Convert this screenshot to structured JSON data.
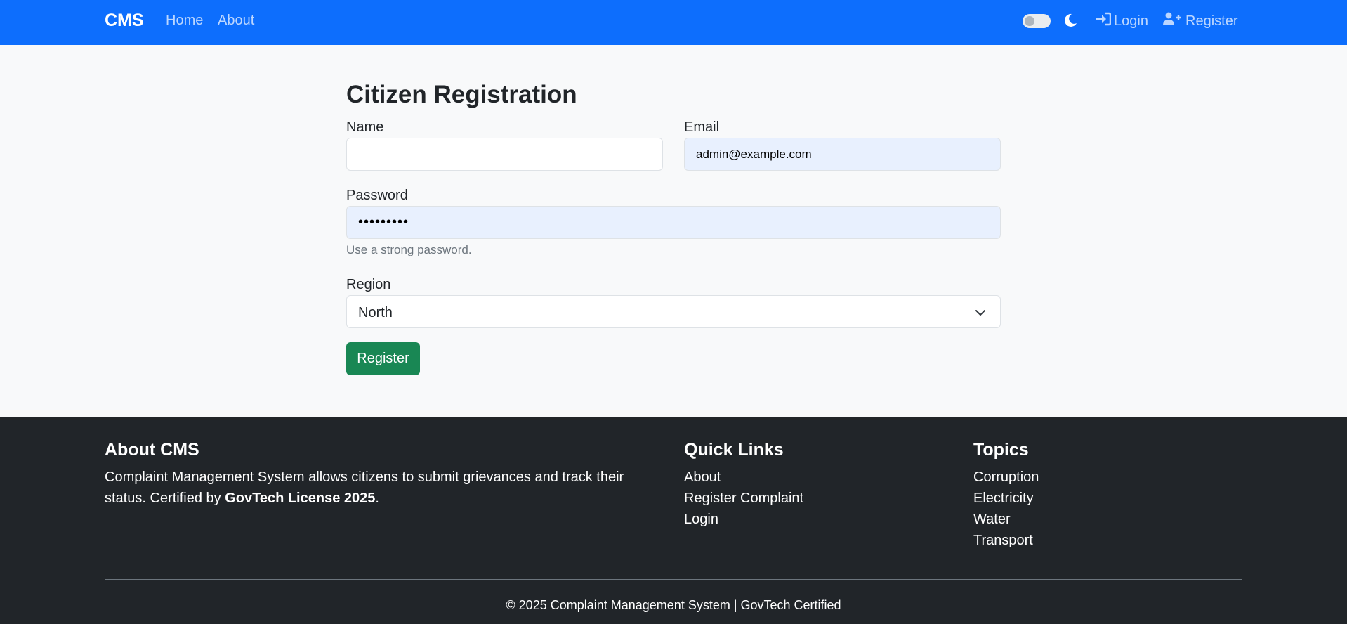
{
  "navbar": {
    "brand": "CMS",
    "links": [
      "Home",
      "About"
    ],
    "login_label": "Login",
    "register_label": "Register",
    "theme_toggle": "off",
    "icons": [
      "moon-icon",
      "login-icon",
      "user-plus-icon"
    ]
  },
  "form": {
    "title": "Citizen Registration",
    "name_label": "Name",
    "name_value": "",
    "email_label": "Email",
    "email_value": "admin@example.com",
    "password_label": "Password",
    "password_value": "•••••••••",
    "password_help": "Use a strong password.",
    "region_label": "Region",
    "region_value": "North",
    "submit_label": "Register"
  },
  "footer": {
    "about_heading": "About CMS",
    "about_text": "Complaint Management System allows citizens to submit grievances and track their status. Certified by ",
    "about_bold": "GovTech License 2025",
    "about_tail": ".",
    "links_heading": "Quick Links",
    "links": [
      "About",
      "Register Complaint",
      "Login"
    ],
    "topics_heading": "Topics",
    "topics": [
      "Corruption",
      "Electricity",
      "Water",
      "Transport"
    ],
    "copyright": "© 2025 Complaint Management System | GovTech Certified"
  },
  "colors": {
    "navbar": "#0d6efd",
    "button": "#198754",
    "footer": "#212529",
    "autofill": "#e8f0fe"
  }
}
